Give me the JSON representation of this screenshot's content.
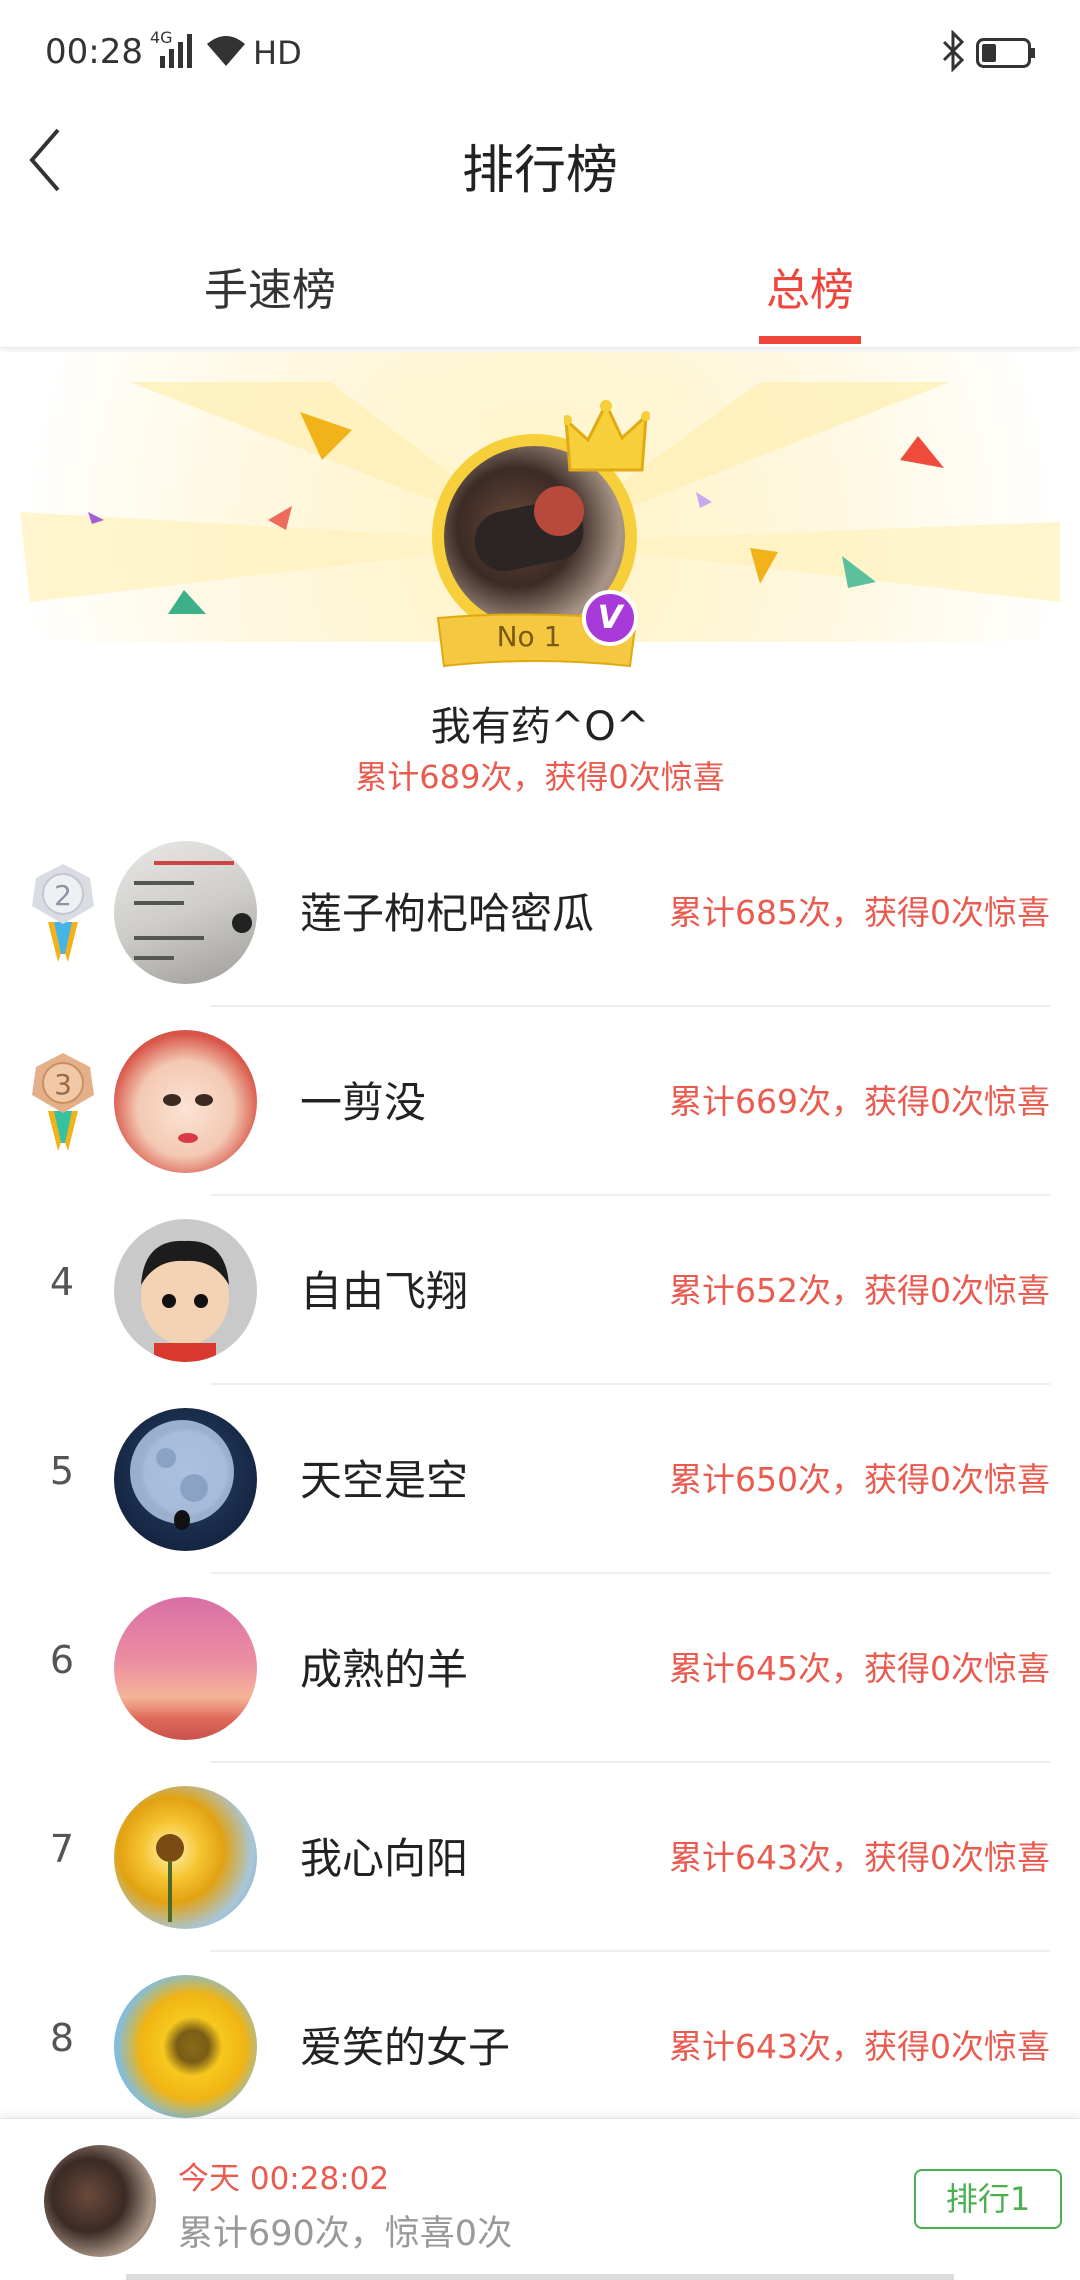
{
  "status_bar": {
    "time": "00:28",
    "network": "4G",
    "hd": "HD"
  },
  "header": {
    "title": "排行榜"
  },
  "tabs": [
    {
      "label": "手速榜",
      "active": false
    },
    {
      "label": "总榜",
      "active": true
    }
  ],
  "champion": {
    "rank_badge": "No 1",
    "verified_mark": "V",
    "name": "我有药^O^",
    "stat": "累计689次，获得0次惊喜"
  },
  "rankings": [
    {
      "rank": "2",
      "medal": "silver",
      "name": "莲子枸杞哈密瓜",
      "stat": "累计685次，获得0次惊喜"
    },
    {
      "rank": "3",
      "medal": "bronze",
      "name": "一剪没",
      "stat": "累计669次，获得0次惊喜"
    },
    {
      "rank": "4",
      "name": "自由飞翔",
      "stat": "累计652次，获得0次惊喜"
    },
    {
      "rank": "5",
      "name": "天空是空",
      "stat": "累计650次，获得0次惊喜"
    },
    {
      "rank": "6",
      "name": "成熟的羊",
      "stat": "累计645次，获得0次惊喜"
    },
    {
      "rank": "7",
      "name": "我心向阳",
      "stat": "累计643次，获得0次惊喜"
    },
    {
      "rank": "8",
      "name": "爱笑的女子",
      "stat": "累计643次，获得0次惊喜"
    }
  ],
  "footer": {
    "time": "今天 00:28:02",
    "stat": "累计690次，惊喜0次",
    "rank_button": "排行1"
  },
  "colors": {
    "accent": "#f0453a",
    "stat_red": "#ea5a4e",
    "green": "#4caf50",
    "gold": "#f7cf3a"
  }
}
